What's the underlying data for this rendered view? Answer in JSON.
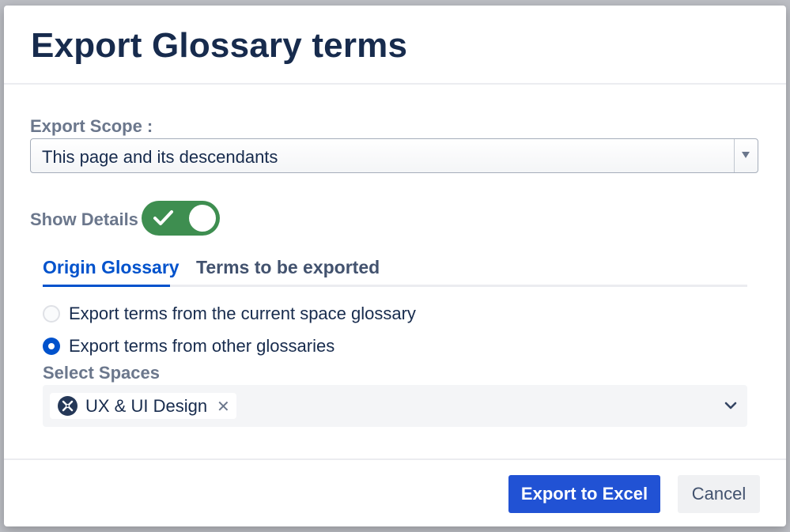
{
  "dialog": {
    "title": "Export Glossary terms"
  },
  "scope": {
    "label": "Export Scope :",
    "selected": "This page and its descendants"
  },
  "details": {
    "label": "Show Details",
    "enabled": true
  },
  "tabs": [
    {
      "label": "Origin Glossary",
      "active": true
    },
    {
      "label": "Terms to be exported",
      "active": false
    }
  ],
  "origin": {
    "options": [
      {
        "label": "Export terms from the current space glossary",
        "selected": false
      },
      {
        "label": "Export terms from other glossaries",
        "selected": true
      }
    ]
  },
  "spaces": {
    "label": "Select Spaces",
    "chips": [
      {
        "label": "UX & UI Design",
        "icon": "space-avatar-icon"
      }
    ]
  },
  "footer": {
    "primary_label": "Export to Excel",
    "secondary_label": "Cancel"
  },
  "colors": {
    "title": "#172b4d",
    "primary": "#2152d4",
    "toggle_on": "#3e8e50",
    "tab_active": "#0052cc"
  }
}
